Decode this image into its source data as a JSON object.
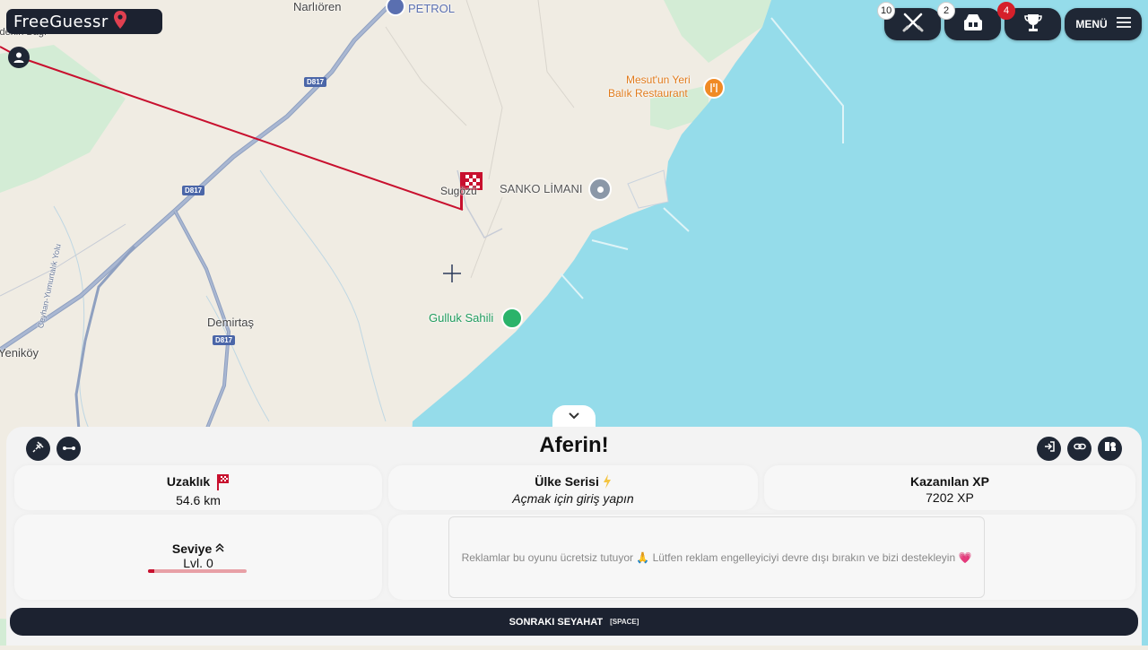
{
  "app": {
    "logo_text": "FreeGuessr"
  },
  "map": {
    "labels": {
      "narlioren": "Narlıören",
      "petrol": "PETROL",
      "bagi": "Bedenin Bağı",
      "restaurant_line1": "Mesut'un Yeri",
      "restaurant_line2": "Balık Restaurant",
      "sugozu": "Sugözü",
      "sanko": "SANKO LİMANI",
      "gulluk": "Gulluk Sahili",
      "demirtas": "Demirtaş",
      "yenikoy": "Yeniköy",
      "road_vertical": "Ceyhan-Yumurtalık Yolu"
    },
    "road_shields": {
      "d817_a": "D817",
      "d817_b": "D817",
      "d817_c": "D817"
    },
    "colors": {
      "land": "#f0ece3",
      "water": "#95dcea",
      "park": "#d2ecd4",
      "road": "#8fa0c0",
      "guess_line": "#c8102e"
    }
  },
  "topbar": {
    "battles_count": "10",
    "parties_count": "2",
    "trophies_count": "4",
    "menu_label": "MENÜ"
  },
  "results": {
    "title": "Aferin!",
    "distance_label": "Uzaklık",
    "distance_value": "54.6 km",
    "streak_label": "Ülke Serisi",
    "streak_value": "Açmak için giriş yapın",
    "xp_label": "Kazanılan XP",
    "xp_value": "7202 XP",
    "level_label": "Seviye",
    "level_value": "Lvl. 0",
    "level_progress": 0.06,
    "ad_text": "Reklamlar bu oyunu ücretsiz tutuyor 🙏 Lütfen reklam engelleyiciyi devre dışı bırakın ve bizi destekleyin 💗",
    "next_label": "SONRAKI SEYAHAT",
    "next_key": "[SPACE]"
  },
  "accent_colors": {
    "dark": "#1c2230",
    "red": "#d5202b",
    "yellow": "#f4c542"
  }
}
